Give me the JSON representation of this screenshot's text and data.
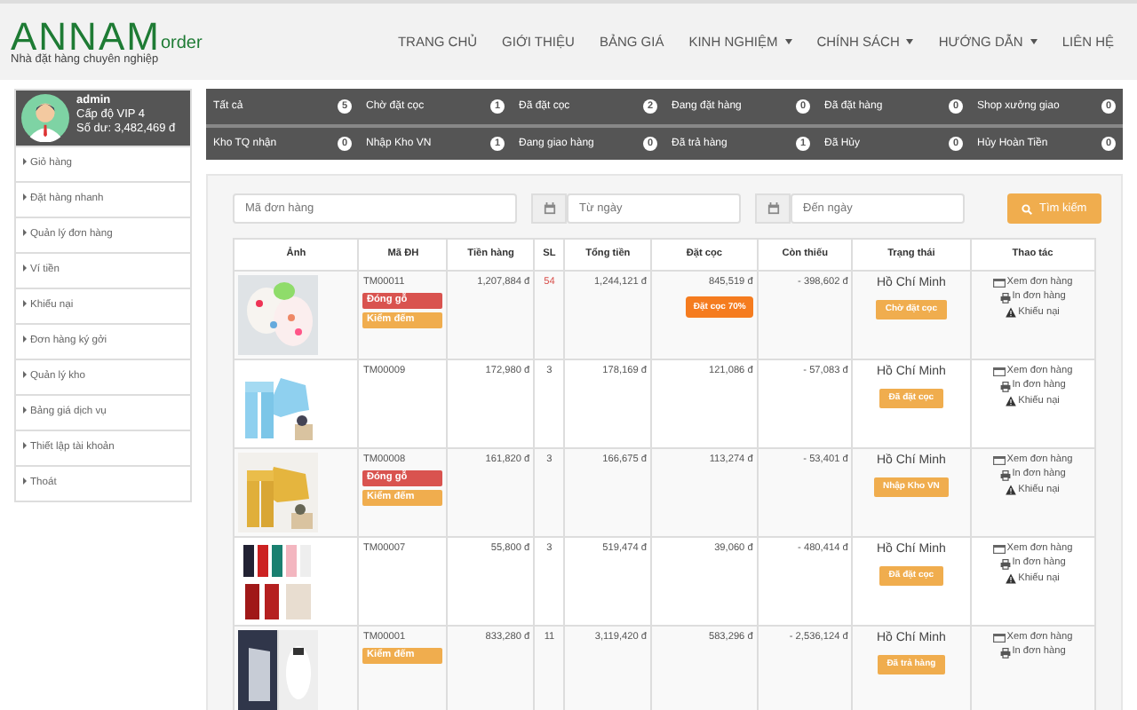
{
  "logo": {
    "brand": "ANNAM",
    "suffix": "order",
    "tagline": "Nhà đặt hàng chuyên nghiệp"
  },
  "nav": [
    {
      "label": "TRANG CHỦ",
      "dropdown": false
    },
    {
      "label": "GIỚI THIỆU",
      "dropdown": false
    },
    {
      "label": "BẢNG GIÁ",
      "dropdown": false
    },
    {
      "label": "KINH NGHIỆM",
      "dropdown": true
    },
    {
      "label": "CHÍNH SÁCH",
      "dropdown": true
    },
    {
      "label": "HƯỚNG DẪN",
      "dropdown": true
    },
    {
      "label": "LIÊN HỆ",
      "dropdown": false
    }
  ],
  "profile": {
    "username": "admin",
    "level": "Cấp độ VIP 4",
    "balance": "Số dư: 3,482,469 đ"
  },
  "sidebar": {
    "items": [
      "Giỏ hàng",
      "Đặt hàng nhanh",
      "Quản lý đơn hàng",
      "Ví tiền",
      "Khiếu nại",
      "Đơn hàng ký gởi",
      "Quản lý kho",
      "Bảng giá dịch vụ",
      "Thiết lập tài khoản",
      "Thoát"
    ]
  },
  "status_tabs": [
    {
      "label": "Tất cả",
      "count": "5"
    },
    {
      "label": "Chờ đặt cọc",
      "count": "1"
    },
    {
      "label": "Đã đặt cọc",
      "count": "2"
    },
    {
      "label": "Đang đặt hàng",
      "count": "0"
    },
    {
      "label": "Đã đặt hàng",
      "count": "0"
    },
    {
      "label": "Shop xưởng giao",
      "count": "0"
    },
    {
      "label": "Kho TQ nhận",
      "count": "0"
    },
    {
      "label": "Nhập Kho VN",
      "count": "1"
    },
    {
      "label": "Đang giao hàng",
      "count": "0"
    },
    {
      "label": "Đã trả hàng",
      "count": "1"
    },
    {
      "label": "Đã Hủy",
      "count": "0"
    },
    {
      "label": "Hủy Hoàn Tiền",
      "count": "0"
    }
  ],
  "filter": {
    "order_code": {
      "placeholder": "Mã đơn hàng"
    },
    "from_date": {
      "placeholder": "Từ ngày"
    },
    "to_date": {
      "placeholder": "Đến ngày"
    },
    "search_button": "Tìm kiếm"
  },
  "table": {
    "columns": [
      "Ảnh",
      "Mã ĐH",
      "Tiền hàng",
      "SL",
      "Tổng tiền",
      "Đặt cọc",
      "Còn thiếu",
      "Trạng thái",
      "Thao tác"
    ],
    "rows": [
      {
        "image": {
          "kind": "picture"
        },
        "code": "TM00011",
        "tags": [
          {
            "label": "Đóng gỗ",
            "color": "#d9534f"
          },
          {
            "label": "Kiểm đếm",
            "color": "#f0ad4e"
          }
        ],
        "goods": "1,207,884 đ",
        "qty": "54",
        "qty_alert": true,
        "total": "1,244,121 đ",
        "deposit": "845,519 đ",
        "deposit_button": "Đặt cọc 70%",
        "remaining": "- 398,602 đ",
        "warehouse": "Hồ Chí Minh",
        "status": "Chờ đặt cọc",
        "actions": [
          {
            "kind": "view",
            "label": "Xem đơn hàng"
          },
          {
            "kind": "print",
            "label": "In đơn hàng"
          },
          {
            "kind": "complaint",
            "label": "Khiếu nại"
          }
        ]
      },
      {
        "image": {
          "kind": "picture"
        },
        "code": "TM00009",
        "tags": [],
        "goods": "172,980 đ",
        "qty": "3",
        "qty_alert": false,
        "total": "178,169 đ",
        "deposit": "121,086 đ",
        "remaining": "- 57,083 đ",
        "warehouse": "Hồ Chí Minh",
        "status": "Đã đặt cọc",
        "actions": [
          {
            "kind": "view",
            "label": "Xem đơn hàng"
          },
          {
            "kind": "print",
            "label": "In đơn hàng"
          },
          {
            "kind": "complaint",
            "label": "Khiếu nại"
          }
        ]
      },
      {
        "image": {
          "kind": "picture"
        },
        "code": "TM00008",
        "tags": [
          {
            "label": "Đóng gỗ",
            "color": "#d9534f"
          },
          {
            "label": "Kiểm đếm",
            "color": "#f0ad4e"
          }
        ],
        "goods": "161,820 đ",
        "qty": "3",
        "qty_alert": false,
        "total": "166,675 đ",
        "deposit": "113,274 đ",
        "remaining": "- 53,401 đ",
        "warehouse": "Hồ Chí Minh",
        "status": "Nhập Kho VN",
        "actions": [
          {
            "kind": "view",
            "label": "Xem đơn hàng"
          },
          {
            "kind": "print",
            "label": "In đơn hàng"
          },
          {
            "kind": "complaint",
            "label": "Khiếu nại"
          }
        ]
      },
      {
        "image": {
          "kind": "picture"
        },
        "code": "TM00007",
        "tags": [],
        "goods": "55,800 đ",
        "qty": "3",
        "qty_alert": false,
        "total": "519,474 đ",
        "deposit": "39,060 đ",
        "remaining": "- 480,414 đ",
        "warehouse": "Hồ Chí Minh",
        "status": "Đã đặt cọc",
        "actions": [
          {
            "kind": "view",
            "label": "Xem đơn hàng"
          },
          {
            "kind": "print",
            "label": "In đơn hàng"
          },
          {
            "kind": "complaint",
            "label": "Khiếu nại"
          }
        ]
      },
      {
        "image": {
          "kind": "picture"
        },
        "code": "TM00001",
        "tags": [
          {
            "label": "Kiểm đếm",
            "color": "#f0ad4e"
          }
        ],
        "goods": "833,280 đ",
        "qty": "11",
        "qty_alert": false,
        "total": "3,119,420 đ",
        "deposit": "583,296 đ",
        "remaining": "- 2,536,124 đ",
        "warehouse": "Hồ Chí Minh",
        "status": "Đã trả hàng",
        "actions": [
          {
            "kind": "view",
            "label": "Xem đơn hàng"
          },
          {
            "kind": "print",
            "label": "In đơn hàng"
          }
        ]
      }
    ]
  }
}
